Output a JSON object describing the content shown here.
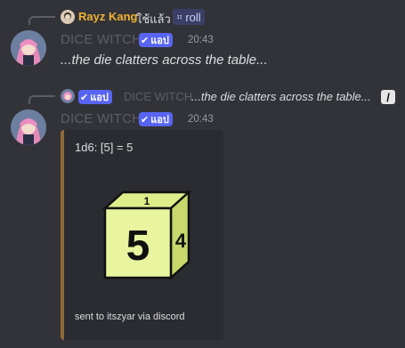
{
  "reply1": {
    "author": "Rayz Kang",
    "action": "ใช้แล้ว",
    "command": "roll",
    "author_color": "#f0b232"
  },
  "message1": {
    "author": "DICE WITCH",
    "badge": "แอป",
    "time": "20:43",
    "content": "...the die clatters across the table..."
  },
  "reply2": {
    "badge": "แอป",
    "author": "DICE WITCH",
    "content": "...the die clatters across the table..."
  },
  "message2": {
    "author": "DICE WITCH",
    "badge": "แอป",
    "time": "20:43"
  },
  "embed": {
    "title": "1d6: [5] = 5",
    "footer": "sent to itszyar via discord",
    "die_face": "5",
    "die_side": "4",
    "die_top": "1",
    "accent": "#8f6a36"
  },
  "icons": {
    "badge_check": "checkmark-icon",
    "command": "slash-command-icon",
    "reply_slash": "slash-icon"
  }
}
